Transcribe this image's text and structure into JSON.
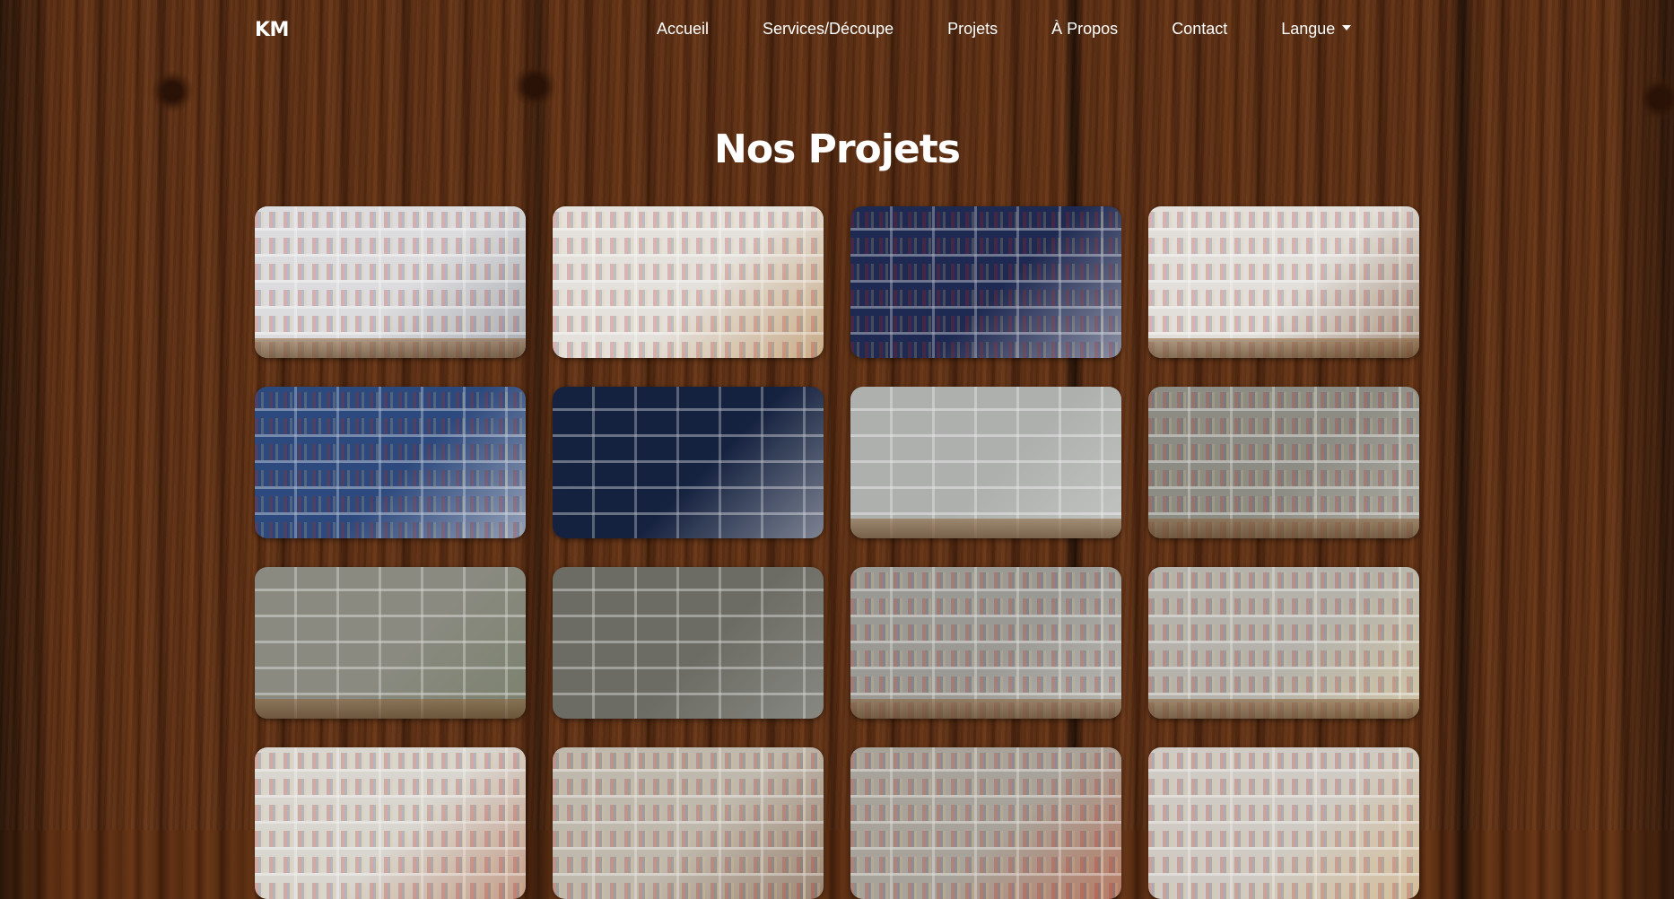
{
  "brand": "KM",
  "nav": {
    "items": [
      "Accueil",
      "Services/Découpe",
      "Projets",
      "À Propos",
      "Contact"
    ],
    "language_label": "Langue"
  },
  "heading": "Nos Projets",
  "projects": [
    {
      "name": "project-photo-1",
      "bg": "#dcdcde",
      "accent": "#7a7f8a",
      "books": true,
      "floor": true
    },
    {
      "name": "project-photo-2",
      "bg": "#e4e1dc",
      "accent": "#b07a3c",
      "books": true,
      "floor": false
    },
    {
      "name": "project-photo-3",
      "bg": "#1f2a52",
      "accent": "#e8e8ea",
      "books": true,
      "floor": false
    },
    {
      "name": "project-photo-4",
      "bg": "#e2dfdb",
      "accent": "#6e4a2c",
      "books": true,
      "floor": true
    },
    {
      "name": "project-photo-5",
      "bg": "#2d4a7e",
      "accent": "#f0ece6",
      "books": true,
      "floor": false
    },
    {
      "name": "project-photo-6",
      "bg": "#14213f",
      "accent": "#d9d9db",
      "books": false,
      "floor": false
    },
    {
      "name": "project-photo-7",
      "bg": "#aeb0ae",
      "accent": "#d4d6d4",
      "books": false,
      "floor": true
    },
    {
      "name": "project-photo-8",
      "bg": "#8d8c84",
      "accent": "#c9c7bd",
      "books": true,
      "floor": true
    },
    {
      "name": "project-photo-9",
      "bg": "#8a8a80",
      "accent": "#6f7a5e",
      "books": false,
      "floor": true
    },
    {
      "name": "project-photo-10",
      "bg": "#6c6b64",
      "accent": "#9ea29b",
      "books": false,
      "floor": false
    },
    {
      "name": "project-photo-11",
      "bg": "#9a9993",
      "accent": "#d3d2cd",
      "books": true,
      "floor": true
    },
    {
      "name": "project-photo-12",
      "bg": "#b4b2aa",
      "accent": "#e8d7a8",
      "books": true,
      "floor": true
    },
    {
      "name": "project-photo-13",
      "bg": "#d9d6d0",
      "accent": "#b06a4a",
      "books": true,
      "floor": false
    },
    {
      "name": "project-photo-14",
      "bg": "#bfb8ac",
      "accent": "#7e5b45",
      "books": true,
      "floor": false
    },
    {
      "name": "project-photo-15",
      "bg": "#a8a39a",
      "accent": "#c45a3a",
      "books": true,
      "floor": false
    },
    {
      "name": "project-photo-16",
      "bg": "#cfcbc4",
      "accent": "#d8b27a",
      "books": true,
      "floor": false
    }
  ]
}
